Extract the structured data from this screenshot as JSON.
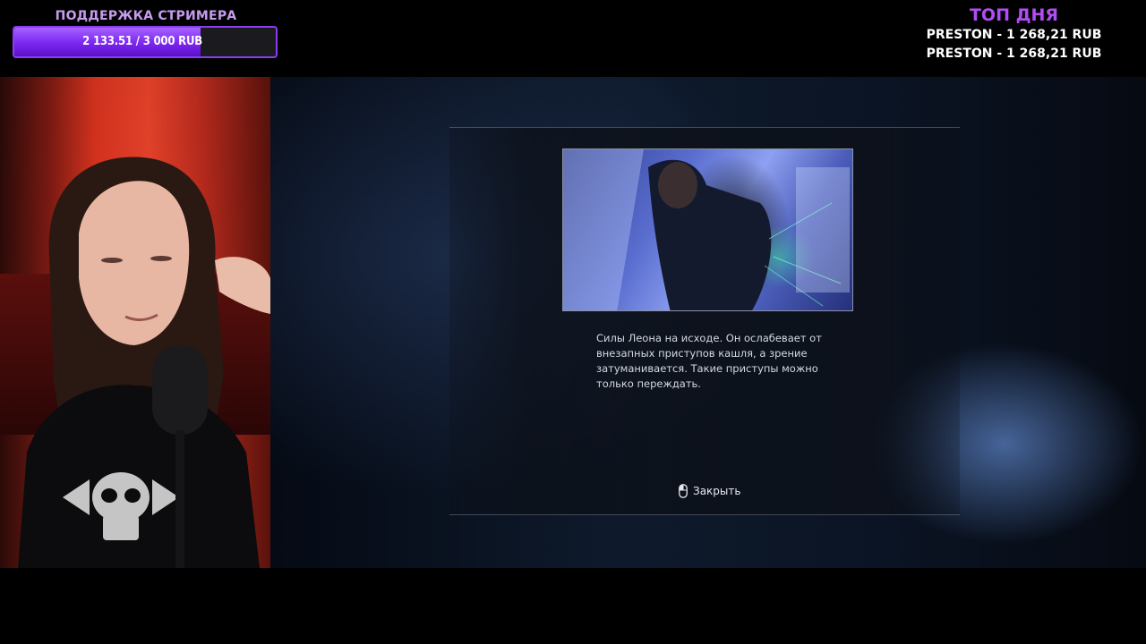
{
  "overlay": {
    "support": {
      "title": "ПОДДЕРЖКА СТРИМЕРА",
      "progress_text": "2 133.51 / 3 000 RUB",
      "progress_fraction": 0.711
    },
    "top_day": {
      "title": "ТОП ДНЯ",
      "rows": [
        "PRESTON - 1 268,21 RUB",
        "PRESTON - 1 268,21 RUB"
      ]
    }
  },
  "game_dialog": {
    "tip_text": "Силы Леона на исходе. Он ослабевает от внезапных приступов кашля, а зрение затуманивается. Такие приступы можно только переждать.",
    "close_label": "Закрыть",
    "close_icon": "mouse-icon"
  },
  "colors": {
    "accent_purple": "#8a3ef0",
    "top_title": "#b04df5",
    "support_title": "#c69cf0"
  }
}
